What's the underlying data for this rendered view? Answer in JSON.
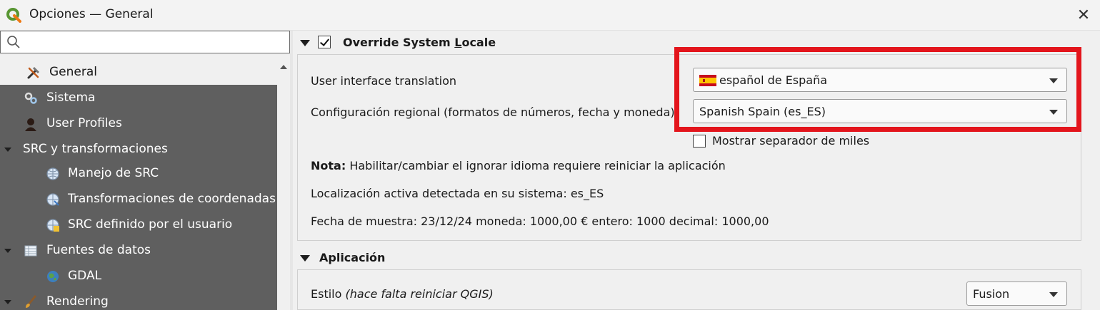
{
  "window": {
    "title": "Opciones — General",
    "close_glyph": "✕"
  },
  "search": {
    "value": "",
    "placeholder": ""
  },
  "sidebar": {
    "items": [
      {
        "label": "General",
        "icon": "tools-icon",
        "level": 0,
        "selected": true
      },
      {
        "label": "Sistema",
        "icon": "gears-icon",
        "level": 0
      },
      {
        "label": "User Profiles",
        "icon": "user-icon",
        "level": 0
      },
      {
        "label": "SRC y transformaciones",
        "icon": "",
        "level": 0,
        "expanded": true
      },
      {
        "label": "Manejo de SRC",
        "icon": "globe-icon",
        "level": 1
      },
      {
        "label": "Transformaciones de coordenadas",
        "icon": "globe-transform-icon",
        "level": 1
      },
      {
        "label": "SRC definido por el usuario",
        "icon": "globe-user-icon",
        "level": 1
      },
      {
        "label": "Fuentes de datos",
        "icon": "table-icon",
        "level": 0,
        "expanded": true
      },
      {
        "label": "GDAL",
        "icon": "gdal-globe-icon",
        "level": 1
      },
      {
        "label": "Rendering",
        "icon": "brush-icon",
        "level": 0,
        "expanded": true
      }
    ]
  },
  "locale_section": {
    "title_pre": "Override System ",
    "title_underline": "L",
    "title_post": "ocale",
    "checked": true,
    "ui_translation_label": "User interface translation",
    "ui_translation_value": "español de España",
    "regional_label": "Configuración regional (formatos de números, fecha y moneda)",
    "regional_value": "Spanish Spain (es_ES)",
    "thousands_label": "Mostrar separador de miles",
    "note_bold": "Nota:",
    "note_text": " Habilitar/cambiar el ignorar idioma requiere reiniciar la aplicación",
    "detected_locale": "Localización activa detectada en su sistema: es_ES",
    "sample": "Fecha de muestra: 23/12/24 moneda: 1000,00 € entero: 1000 decimal: 1000,00"
  },
  "app_section": {
    "title": "Aplicación",
    "style_label": "Estilo",
    "style_note": "(hace falta reiniciar QGIS)",
    "style_value": "Fusion"
  },
  "colors": {
    "highlight": "#e3151c",
    "sidebar_bg": "#5f5f5f",
    "qgis_green": "#589632",
    "qgis_yellow": "#ee7913"
  }
}
